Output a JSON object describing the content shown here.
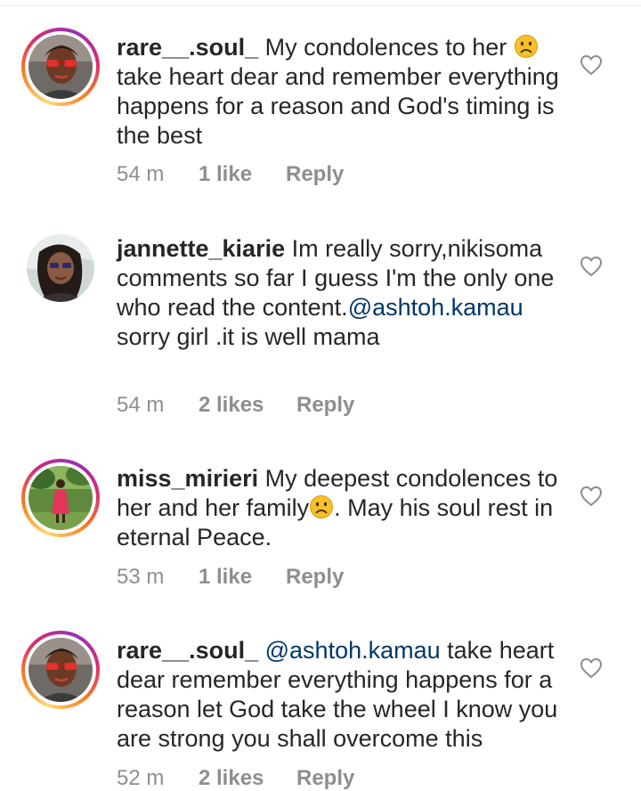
{
  "comments": [
    {
      "username": "rare__.soul_",
      "text_1": "My condolences to her",
      "text_2": "take heart dear and remember everything happens for a reason and God's timing is the best",
      "emoji": "frowning-face",
      "time": "54 m",
      "likes": "1 like",
      "reply": "Reply",
      "story_ring": true
    },
    {
      "username": "jannette_kiarie",
      "text_1": "Im really sorry,nikisoma comments so far I guess I'm the only one who read the content.",
      "mention": "@ashtoh.kamau",
      "text_2": "sorry girl .it is well mama",
      "time": "54 m",
      "likes": "2 likes",
      "reply": "Reply",
      "story_ring": false
    },
    {
      "username": "miss_mirieri",
      "text_1": "My deepest condolences to her and her family",
      "text_2": ". May his soul rest in eternal Peace.",
      "emoji": "frowning-face",
      "time": "53 m",
      "likes": "1 like",
      "reply": "Reply",
      "story_ring": true
    },
    {
      "username": "rare__.soul_",
      "mention": "@ashtoh.kamau",
      "text_1": "take heart dear remember everything happens for a reason let God take the wheel I know you are strong you shall overcome this",
      "time": "52 m",
      "likes": "2 likes",
      "reply": "Reply",
      "story_ring": true
    }
  ],
  "icons": {
    "like": "heart-outline-icon",
    "emoji": "frowning-face-emoji"
  },
  "colors": {
    "text": "#262626",
    "meta": "#8e8e8e",
    "mention": "#00376b",
    "emoji": "#f7c02a"
  }
}
